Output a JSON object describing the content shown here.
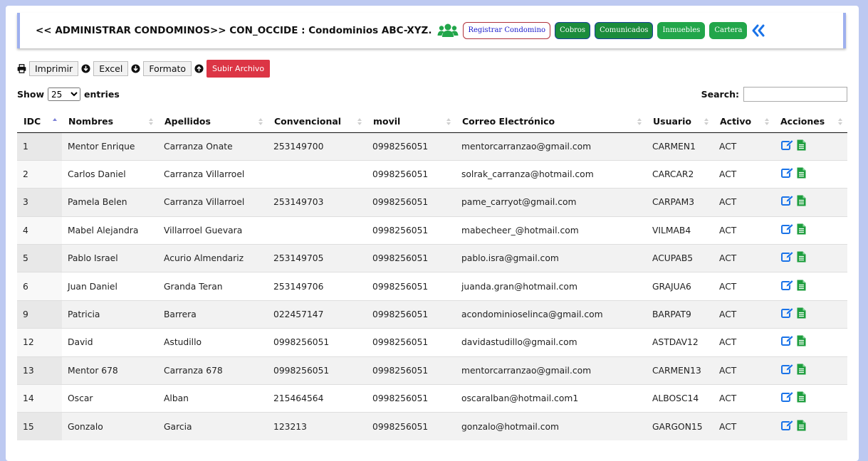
{
  "header": {
    "title": "<< ADMINISTRAR CONDOMINOS>> CON_OCCIDE : Condominios ABC-XYZ.",
    "buttons": {
      "registrar": "Registrar Condomino",
      "cobros": "Cobros",
      "comunicados": "Comunicados",
      "inmuebles": "Inmuebles",
      "cartera": "Cartera"
    },
    "users_icon": "users-icon",
    "back_icon": "double-chevron-left-icon"
  },
  "toolbar": {
    "imprimir": "Imprimir",
    "excel": "Excel",
    "formato": "Formato",
    "subir": "Subir Archivo"
  },
  "length": {
    "show": "Show",
    "value": "25",
    "entries": "entries"
  },
  "search": {
    "label": "Search:",
    "value": ""
  },
  "table": {
    "columns": [
      "IDC",
      "Nombres",
      "Apellidos",
      "Convencional",
      "movil",
      "Correo Electrónico",
      "Usuario",
      "Activo",
      "Acciones"
    ],
    "rows": [
      [
        "1",
        "Mentor Enrique",
        "Carranza Onate",
        "253149700",
        "0998256051",
        "mentorcarranzao@gmail.com",
        "CARMEN1",
        "ACT"
      ],
      [
        "2",
        "Carlos Daniel",
        "Carranza Villarroel",
        "",
        "0998256051",
        "solrak_carranza@hotmail.com",
        "CARCAR2",
        "ACT"
      ],
      [
        "3",
        "Pamela Belen",
        "Carranza Villarroel",
        "253149703",
        "0998256051",
        "pame_carryot@gmail.com",
        "CARPAM3",
        "ACT"
      ],
      [
        "4",
        "Mabel Alejandra",
        "Villarroel Guevara",
        "",
        "0998256051",
        "mabecheer_@hotmail.com",
        "VILMAB4",
        "ACT"
      ],
      [
        "5",
        "Pablo Israel",
        "Acurio Almendariz",
        "253149705",
        "0998256051",
        "pablo.isra@gmail.com",
        "ACUPAB5",
        "ACT"
      ],
      [
        "6",
        "Juan Daniel",
        "Granda Teran",
        "253149706",
        "0998256051",
        "juanda.gran@hotmail.com",
        "GRAJUA6",
        "ACT"
      ],
      [
        "9",
        "Patricia",
        "Barrera",
        "022457147",
        "0998256051",
        "acondominioselinca@gmail.com",
        "BARPAT9",
        "ACT"
      ],
      [
        "12",
        "David",
        "Astudillo",
        "0998256051",
        "0998256051",
        "davidastudillo@gmail.com",
        "ASTDAV12",
        "ACT"
      ],
      [
        "13",
        "Mentor 678",
        "Carranza 678",
        "0998256051",
        "0998256051",
        "mentorcarranzao@gmail.com",
        "CARMEN13",
        "ACT"
      ],
      [
        "14",
        "Oscar",
        "Alban",
        "215464564",
        "0998256051",
        "oscaralban@hotmail.com1",
        "ALBOSC14",
        "ACT"
      ],
      [
        "15",
        "Gonzalo",
        "Garcia",
        "123213",
        "0998256051",
        "gonzalo@hotmail.com",
        "GARGON15",
        "ACT"
      ]
    ],
    "action_icons": [
      "edit-icon",
      "file-text-icon"
    ]
  },
  "colors": {
    "page_bg": "#bdc9f1",
    "green": "#22a64a",
    "danger": "#dc3545",
    "link_blue": "#1a73e8"
  }
}
